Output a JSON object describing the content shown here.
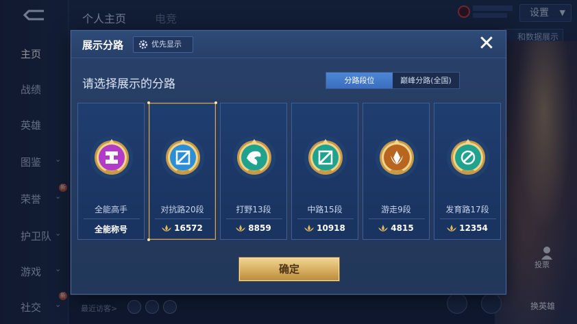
{
  "background": {
    "top_tabs": [
      "个人主页",
      "电竞"
    ],
    "settings_label": "设置",
    "right_button_label": "和数据展示",
    "nav": [
      {
        "label": "主页",
        "active": true
      },
      {
        "label": "战绩"
      },
      {
        "label": "英雄"
      },
      {
        "label": "图鉴",
        "has_chevron": true
      },
      {
        "label": "荣誉",
        "has_chevron": true,
        "badge": "新"
      },
      {
        "label": "护卫队",
        "has_chevron": true
      },
      {
        "label": "游戏",
        "has_chevron": true
      },
      {
        "label": "社交",
        "has_chevron": true,
        "badge": "新"
      }
    ],
    "recent_visitors": "最近访客>",
    "vote_label": "投票",
    "swap_hero_label": "换英雄"
  },
  "modal": {
    "title": "展示分路",
    "priority_button": "优先显示",
    "close_icon": "close-icon",
    "subtitle": "请选择展示的分路",
    "toggle": {
      "options": [
        "分路段位",
        "巅峰分路(全国)"
      ],
      "selected": 0
    },
    "cards": [
      {
        "name": "全能高手",
        "score": "全能称号",
        "show_lotus": false,
        "emblem": "allround-emblem-icon",
        "color": "#b23bc9",
        "selected": false
      },
      {
        "name": "对抗路20段",
        "score": "16572",
        "show_lotus": true,
        "emblem": "clash-lane-emblem-icon",
        "color": "#2b8fd8",
        "selected": true
      },
      {
        "name": "打野13段",
        "score": "8859",
        "show_lotus": true,
        "emblem": "jungle-emblem-icon",
        "color": "#1fa38e",
        "selected": false
      },
      {
        "name": "中路15段",
        "score": "10918",
        "show_lotus": true,
        "emblem": "mid-lane-emblem-icon",
        "color": "#1fa38e",
        "selected": false
      },
      {
        "name": "游走9段",
        "score": "4815",
        "show_lotus": true,
        "emblem": "roam-emblem-icon",
        "color": "#b8661f",
        "selected": false
      },
      {
        "name": "发育路17段",
        "score": "12354",
        "show_lotus": true,
        "emblem": "farm-lane-emblem-icon",
        "color": "#1fa38e",
        "selected": false
      }
    ],
    "confirm_button": "确定"
  }
}
